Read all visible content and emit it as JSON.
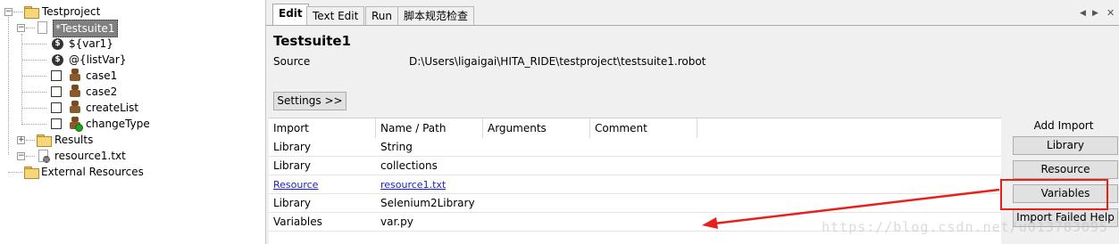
{
  "tree": {
    "project": "Testproject",
    "suite": "*Testsuite1",
    "items": [
      "${var1}",
      "@{listVar}",
      "case1",
      "case2",
      "createList",
      "changeType"
    ],
    "results": "Results",
    "resource": "resource1.txt",
    "external": "External Resources"
  },
  "tabs": [
    "Edit",
    "Text Edit",
    "Run",
    "脚本规范检查"
  ],
  "editor": {
    "title": "Testsuite1",
    "source_label": "Source",
    "source_path": "D:\\Users\\ligaigai\\HITA_RIDE\\testproject\\testsuite1.robot",
    "settings_button": "Settings >>"
  },
  "import_table": {
    "headers": [
      "Import",
      "Name / Path",
      "Arguments",
      "Comment"
    ],
    "rows": [
      {
        "import": "Library",
        "name": "String"
      },
      {
        "import": "Library",
        "name": "collections"
      },
      {
        "import": "Resource",
        "name": "resource1.txt"
      },
      {
        "import": "Library",
        "name": "Selenium2Library"
      },
      {
        "import": "Variables",
        "name": "var.py"
      }
    ]
  },
  "side": {
    "title": "Add Import",
    "buttons": [
      "Library",
      "Resource",
      "Variables",
      "Import Failed Help"
    ]
  },
  "watermark": "https://blog.csdn.net/u013783095",
  "colors": {
    "highlight": "#e8201c",
    "link": "#1a1ad8",
    "selection": "#808080"
  }
}
